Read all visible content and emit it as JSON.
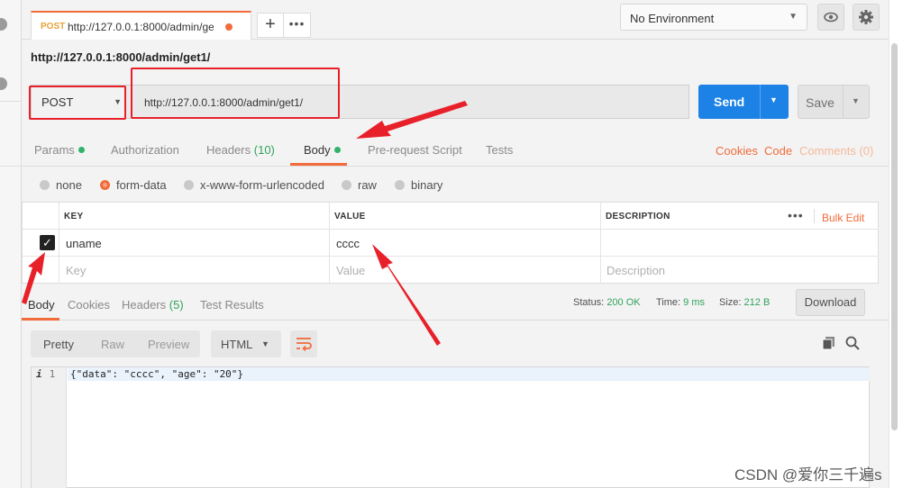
{
  "tab": {
    "method": "POST",
    "url": "http://127.0.0.1:8000/admin/ge",
    "add_icon": "plus-icon",
    "more_icon": "more-icon"
  },
  "environment": {
    "selected": "No Environment",
    "eye_icon": "eye-icon",
    "settings_icon": "gear-icon"
  },
  "request": {
    "name": "http://127.0.0.1:8000/admin/get1/",
    "method": "POST",
    "url": "http://127.0.0.1:8000/admin/get1/",
    "send_label": "Send",
    "save_label": "Save"
  },
  "request_tabs": [
    {
      "label": "Params",
      "dot": true
    },
    {
      "label": "Authorization"
    },
    {
      "label": "Headers",
      "count": "(10)"
    },
    {
      "label": "Body",
      "dot": true,
      "active": true
    },
    {
      "label": "Pre-request Script"
    },
    {
      "label": "Tests"
    }
  ],
  "request_links": {
    "cookies": "Cookies",
    "code": "Code",
    "comments": "Comments (0)"
  },
  "body_types": [
    {
      "label": "none"
    },
    {
      "label": "form-data",
      "selected": true
    },
    {
      "label": "x-www-form-urlencoded"
    },
    {
      "label": "raw"
    },
    {
      "label": "binary"
    }
  ],
  "params_table": {
    "headers": {
      "key": "KEY",
      "value": "VALUE",
      "description": "DESCRIPTION"
    },
    "bulk_edit": "Bulk Edit",
    "rows": [
      {
        "checked": true,
        "key": "uname",
        "value": "cccc",
        "description": ""
      }
    ],
    "placeholder": {
      "key": "Key",
      "value": "Value",
      "description": "Description"
    }
  },
  "response_tabs": [
    {
      "label": "Body",
      "active": true
    },
    {
      "label": "Cookies"
    },
    {
      "label": "Headers",
      "count": "(5)"
    },
    {
      "label": "Test Results"
    }
  ],
  "response_meta": {
    "status_label": "Status:",
    "status_value": "200 OK",
    "time_label": "Time:",
    "time_value": "9 ms",
    "size_label": "Size:",
    "size_value": "212 B",
    "download_label": "Download"
  },
  "response_view": {
    "modes": [
      "Pretty",
      "Raw",
      "Preview"
    ],
    "format": "HTML",
    "line_number": "1",
    "line_marker": "i",
    "body": "{\"data\": \"cccc\", \"age\": \"20\"}"
  },
  "watermark": "CSDN @爱你三千遍s",
  "colors": {
    "accent": "#f26b3a",
    "send": "#1c82e6",
    "success": "#2fa35c",
    "annotation": "#e8202a"
  }
}
